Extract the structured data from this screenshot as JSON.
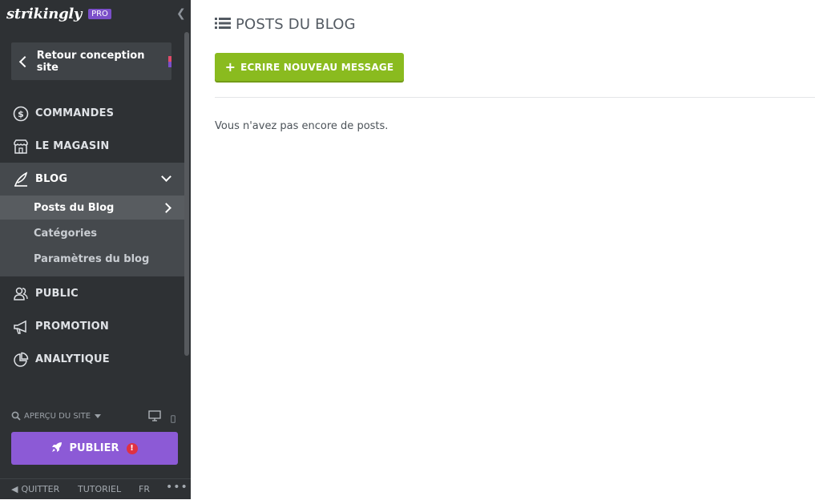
{
  "sidebar": {
    "logo": "strikingly",
    "badge": "PRO",
    "back_label": "Retour conception site",
    "nav": {
      "commandes": "COMMANDES",
      "magasin": "LE MAGASIN",
      "blog": "BLOG",
      "public": "PUBLIC",
      "promotion": "PROMOTION",
      "analytique": "ANALYTIQUE"
    },
    "blog_sub": {
      "posts": "Posts du Blog",
      "categories": "Catégories",
      "settings": "Paramètres du blog"
    },
    "preview_label": "APERÇU DU SITE",
    "publish_label": "PUBLIER",
    "publish_alert": "!",
    "footer": {
      "quit": "QUITTER",
      "tutorial": "TUTORIEL",
      "lang": "FR",
      "more": "•••"
    }
  },
  "main": {
    "title": "POSTS DU BLOG",
    "write_button": "ECRIRE NOUVEAU MESSAGE",
    "empty_message": "Vous n'avez pas encore de posts."
  },
  "colors": {
    "sidebar_bg": "#2e3134",
    "publish": "#8c5ad6",
    "write_button": "#8abb1f",
    "badge": "#7b4fc9"
  },
  "icons": [
    "dollar-circle-icon",
    "store-icon",
    "quill-icon",
    "users-icon",
    "megaphone-icon",
    "pie-chart-icon",
    "search-icon",
    "desktop-icon",
    "mobile-icon",
    "rocket-icon",
    "list-icon",
    "plus-icon"
  ]
}
